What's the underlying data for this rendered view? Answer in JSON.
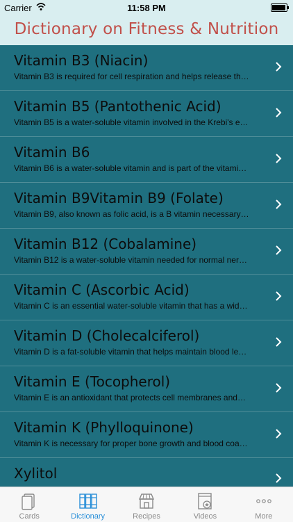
{
  "status": {
    "carrier": "Carrier",
    "time": "11:58 PM"
  },
  "nav": {
    "title": "Dictionary on Fitness & Nutrition"
  },
  "items": [
    {
      "title": "Vitamin B3 (Niacin)",
      "desc": "Vitamin B3 is required for cell respiration and helps release th…"
    },
    {
      "title": "Vitamin B5 (Pantothenic Acid)",
      "desc": "Vitamin B5 is a water-soluble vitamin involved in the Krebi's e…"
    },
    {
      "title": "Vitamin B6",
      "desc": "Vitamin B6 is a water-soluble vitamin and is part of the vitami…"
    },
    {
      "title": "Vitamin B9Vitamin B9 (Folate)",
      "desc": "Vitamin B9, also known as folic acid, is a B vitamin necessary…"
    },
    {
      "title": "Vitamin B12 (Cobalamine)",
      "desc": "Vitamin B12 is a water-soluble vitamin needed for normal ner…"
    },
    {
      "title": "Vitamin C (Ascorbic Acid)",
      "desc": "Vitamin C is an essential water-soluble vitamin that has a wid…"
    },
    {
      "title": "Vitamin D (Cholecalciferol)",
      "desc": "Vitamin D is a fat-soluble vitamin that helps maintain blood le…"
    },
    {
      "title": "Vitamin E (Tocopherol)",
      "desc": "Vitamin E is an antioxidant that protects cell membranes and…"
    },
    {
      "title": "Vitamin K (Phylloquinone)",
      "desc": "Vitamin K is necessary for proper bone growth and blood coa…"
    },
    {
      "title": "Xylitol",
      "desc": ""
    }
  ],
  "tabs": [
    {
      "label": "Cards",
      "icon": "cards-icon"
    },
    {
      "label": "Dictionary",
      "icon": "dictionary-icon"
    },
    {
      "label": "Recipes",
      "icon": "recipes-icon"
    },
    {
      "label": "Videos",
      "icon": "videos-icon"
    },
    {
      "label": "More",
      "icon": "more-icon"
    }
  ],
  "colors": {
    "accent": "#2a8fd8",
    "title": "#c1504a",
    "list_bg": "#1f6f7f",
    "header_bg": "#d9eef0"
  }
}
